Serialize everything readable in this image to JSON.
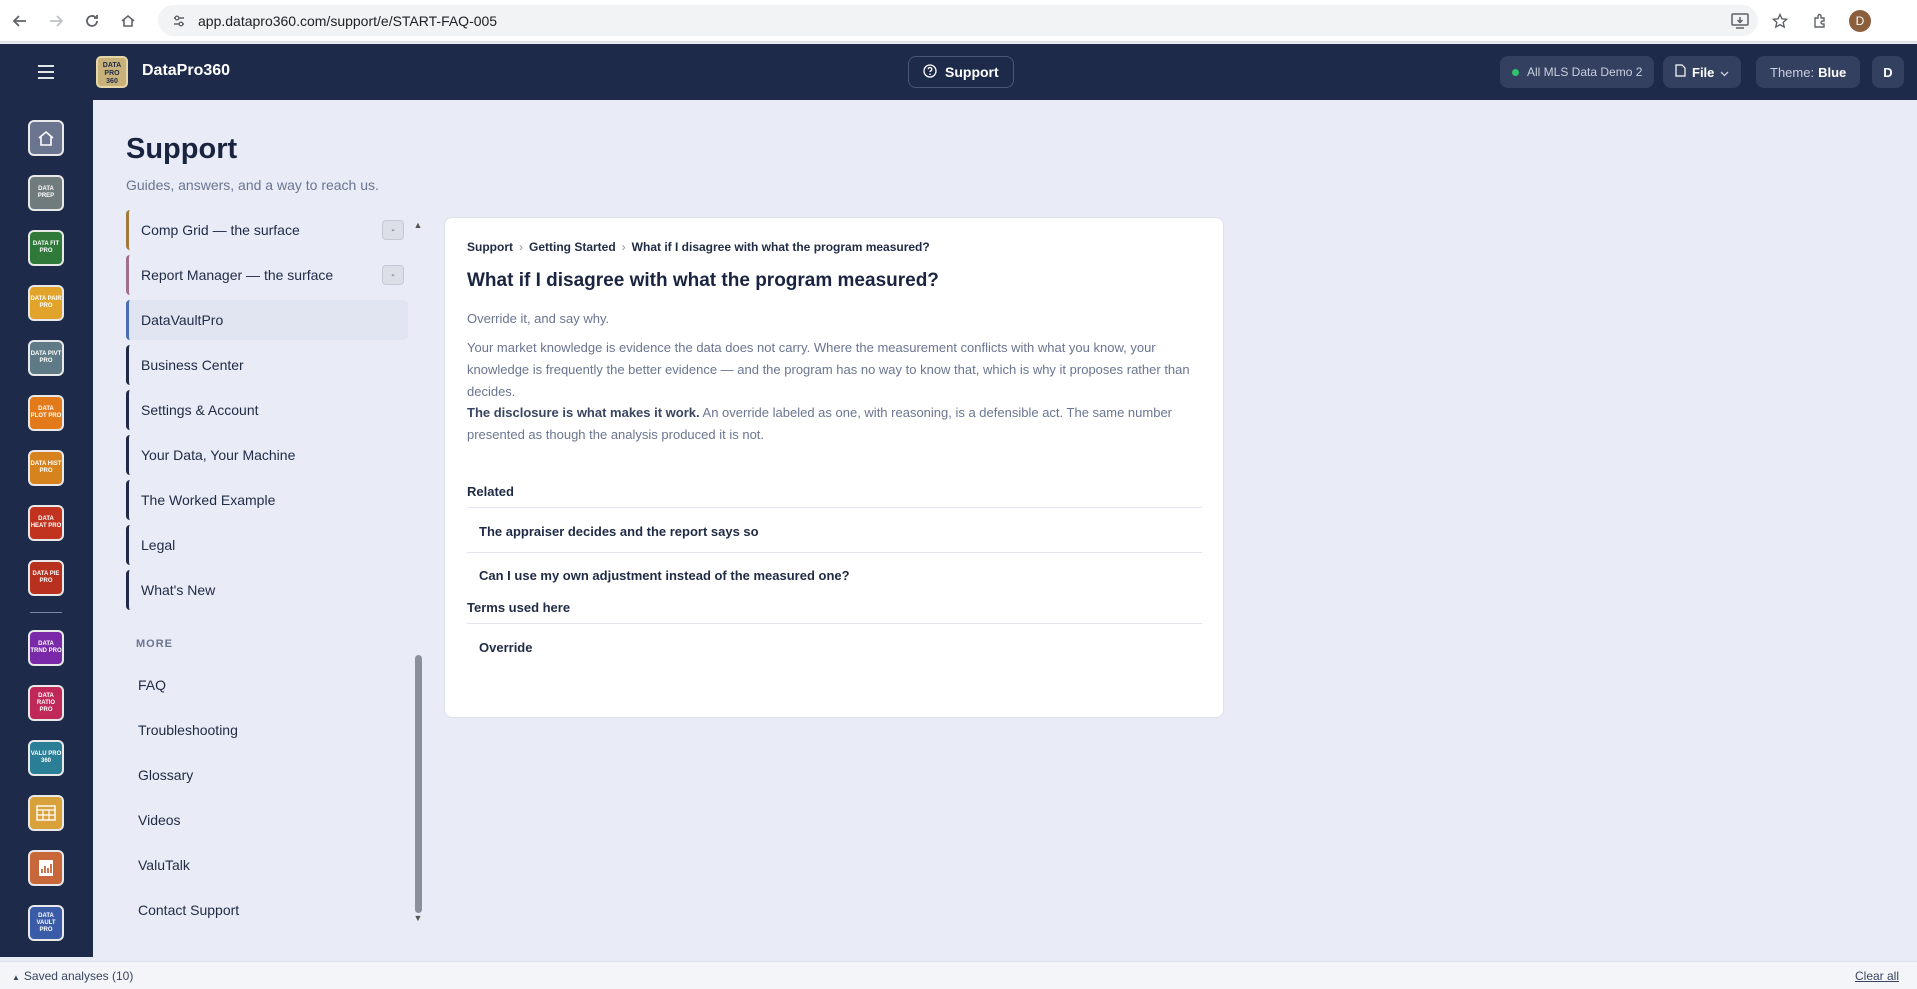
{
  "browser": {
    "url": "app.datapro360.com/support/e/START-FAQ-005",
    "profile_initial": "D"
  },
  "header": {
    "logo_text": "DATA PRO 360",
    "app_name": "DataPro360",
    "support_label": "Support",
    "mls_label": "All MLS Data Demo 2",
    "file_label": "File",
    "theme_prefix": "Theme:",
    "theme_value": "Blue",
    "user_initial": "D"
  },
  "rail": {
    "items": [
      {
        "name": "home",
        "text": "",
        "color": "#6b7590"
      },
      {
        "name": "data-prep",
        "text": "DATA PREP",
        "color": "#6f7b7c"
      },
      {
        "name": "data-fit-pro",
        "text": "DATA FIT PRO",
        "color": "#2f7a3a"
      },
      {
        "name": "data-pair-pro",
        "text": "DATA PAIR PRO",
        "color": "#e2a32a"
      },
      {
        "name": "data-pivt-pro",
        "text": "DATA PIVT PRO",
        "color": "#5e7a86"
      },
      {
        "name": "data-plot-pro",
        "text": "DATA PLOT PRO",
        "color": "#e27a1a"
      },
      {
        "name": "data-hist-pro",
        "text": "DATA HIST PRO",
        "color": "#d7831d"
      },
      {
        "name": "data-heat-pro",
        "text": "DATA HEAT PRO",
        "color": "#c2331f"
      },
      {
        "name": "data-pie-pro",
        "text": "DATA PIE PRO",
        "color": "#b8301e"
      },
      {
        "name": "data-trnd-pro",
        "text": "DATA TRND PRO",
        "color": "#7a2aa8"
      },
      {
        "name": "data-ratio-pro",
        "text": "DATA RATIO PRO",
        "color": "#c0285a"
      },
      {
        "name": "valu-pro-360",
        "text": "VALU PRO 360",
        "color": "#2a7f96"
      },
      {
        "name": "comp-grid",
        "text": "",
        "color": "#d9a13a"
      },
      {
        "name": "report-manager",
        "text": "",
        "color": "#c8683a"
      },
      {
        "name": "data-vault-pro",
        "text": "DATA VAULT PRO",
        "color": "#3a5ca8"
      }
    ]
  },
  "page": {
    "title": "Support",
    "subtitle": "Guides, answers, and a way to reach us."
  },
  "sidebar": {
    "items": [
      {
        "label": "Comp Grid — the surface",
        "toggle": "-"
      },
      {
        "label": "Report Manager — the surface",
        "toggle": "-"
      },
      {
        "label": "DataVaultPro"
      },
      {
        "label": "Business Center"
      },
      {
        "label": "Settings & Account"
      },
      {
        "label": "Your Data, Your Machine"
      },
      {
        "label": "The Worked Example"
      },
      {
        "label": "Legal"
      },
      {
        "label": "What's New"
      }
    ],
    "more_heading": "MORE",
    "more_items": [
      "FAQ",
      "Troubleshooting",
      "Glossary",
      "Videos",
      "ValuTalk",
      "Contact Support"
    ]
  },
  "article": {
    "breadcrumb": [
      "Support",
      "Getting Started",
      "What if I disagree with what the program measured?"
    ],
    "title": "What if I disagree with what the program measured?",
    "lead": "Override it, and say why.",
    "para1": "Your market knowledge is evidence the data does not carry. Where the measurement conflicts with what you know, your knowledge is frequently the better evidence — and the program has no way to know that, which is why it proposes rather than decides.",
    "para2_bold": "The disclosure is what makes it work.",
    "para2_rest": " An override labeled as one, with reasoning, is a defensible act. The same number presented as though the analysis produced it is not.",
    "related_heading": "Related",
    "related": [
      "The appraiser decides and the report says so",
      "Can I use my own adjustment instead of the measured one?"
    ],
    "terms_heading": "Terms used here",
    "terms": [
      "Override"
    ]
  },
  "footer": {
    "saved": "Saved analyses (10)",
    "clear": "Clear all"
  }
}
